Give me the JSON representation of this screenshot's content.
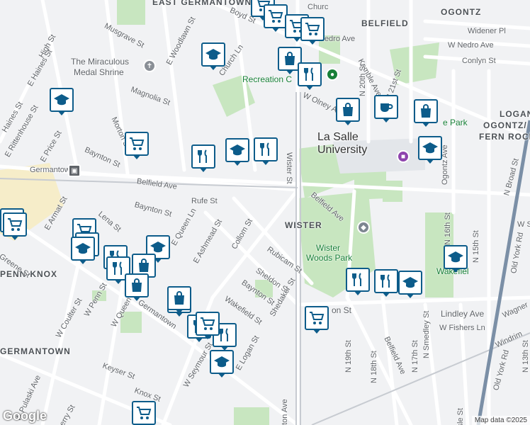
{
  "neighborhoods": {
    "east_germantown": "EAST GERMANTOWN",
    "belfield": "BELFIELD",
    "ogontz": "OGONTZ",
    "logan": "LOGAN/",
    "ogontz_fern": "OGONTZ/",
    "fern_rock": "FERN ROCK",
    "wister": "WISTER",
    "penn_knox": "PENN-KNOX",
    "germantown_hood": "GERMANTOWN"
  },
  "places": {
    "la_salle_1": "La Salle",
    "la_salle_2": "University",
    "shrine_1": "The Miraculous",
    "shrine_2": "Medal Shrine",
    "recreation": "Recreation C",
    "wister_woods": "Wister",
    "wister_woods_2": "Woods Park",
    "germantown_station": "Germantown",
    "wakefield_park": "Wakefiel",
    "fern_park": "e Park"
  },
  "streets": {
    "high_st": "High St",
    "musgrave": "Musgrave St",
    "e_haines": "E Haines St",
    "haines": "Haines St",
    "e_rittenhouse": "E Rittenhouse St",
    "e_price": "E Price St",
    "morton": "Morton St",
    "magnolia": "Magnolia St",
    "e_woodlawn": "E Woodlawn St",
    "church_ln": "Church Ln",
    "boyd": "Boyd St",
    "church_top": "Churc",
    "nedro_ave": "Nedro Ave",
    "w_nedro": "W Nedro Ave",
    "widener": "Widener Pl",
    "conlyn": "Conlyn St",
    "kemble": "Kemble Ave",
    "w_olney": "W Olney Ave",
    "n_20th": "N 20th St",
    "wister_st": "Wister St",
    "bayton_left": "Baynton St",
    "belfield_ave_left": "Belfield Ave",
    "belfield_ave_right": "Belfield Ave",
    "rufe": "Rufe St",
    "baynton_mid": "Baynton St",
    "e_armat": "E Armat St",
    "lena": "Lena St",
    "e_queen": "E Queen Ln",
    "e_ashmead": "E Ashmead St",
    "collom": "Collom St",
    "rubicam": "Rubicam St",
    "sheldon": "Sheldon St",
    "baynton_low": "Baynton St",
    "shedaker": "Shedaker St",
    "wakefield": "Wakefield St",
    "lindley": "Lindley Ave",
    "w_fishers": "W Fishers Ln",
    "n_19th": "N 19th St",
    "n_18th": "N 18th St",
    "n_17th": "N 17th St",
    "n_smedley": "N Smedley St",
    "n_16th": "N 16th St",
    "n_15th": "N 15th St",
    "n_broad": "N Broad St",
    "old_york": "Old York Rd",
    "old_york_low": "Old York Rd",
    "n_13th": "N 13th St",
    "wagner": "Wagner",
    "windrim": "Windrim",
    "e_logan": "E Logan St",
    "w_seymour": "W Seymour St",
    "keyser": "Keyser St",
    "knox": "Knox St",
    "pulaski": "W Pulaski Ave",
    "w_penn": "W Penn St",
    "w_queen": "W Queen Ln",
    "w_coulter": "W Coulter St",
    "greene": "Greene St",
    "germantown_ave": "Germantown",
    "belfield_low": "Belfield Ave",
    "n_16th_upper": "N 16th",
    "oxford": "Ogontz Ave",
    "isle": "isle St",
    "enton": "nton Ave",
    "berry": "berry St",
    "w_st": "W S",
    "n_st": "N 21st St",
    "w_olney_right": "W Olney Ave",
    "olney_st": "on St"
  },
  "markers": {
    "icons": [
      "grocery-cart",
      "grocery-cart",
      "grocery-cart",
      "grocery-cart",
      "school",
      "school",
      "shopping-bag",
      "restaurant",
      "shopping-bag",
      "coffee",
      "shopping-bag",
      "restaurant",
      "school",
      "restaurant",
      "grocery-cart",
      "school",
      "school",
      "grocery-cart",
      "restaurant",
      "grocery-cart",
      "shopping-bag",
      "school",
      "restaurant",
      "shopping-bag",
      "school",
      "shopping-bag",
      "shopping-bag",
      "shopping-bag",
      "restaurant",
      "restaurant",
      "school",
      "grocery-cart",
      "restaurant",
      "restaurant",
      "school",
      "school",
      "grocery-cart",
      "grocery-cart"
    ]
  },
  "attribution": "Map data ©2025",
  "logo": "Google",
  "colors": {
    "marker_border": "#0d5c8a",
    "park": "#c8e6c0",
    "road": "#ffffff",
    "rail": "#c7cbd1",
    "broad_st": "#7b8fa6"
  }
}
